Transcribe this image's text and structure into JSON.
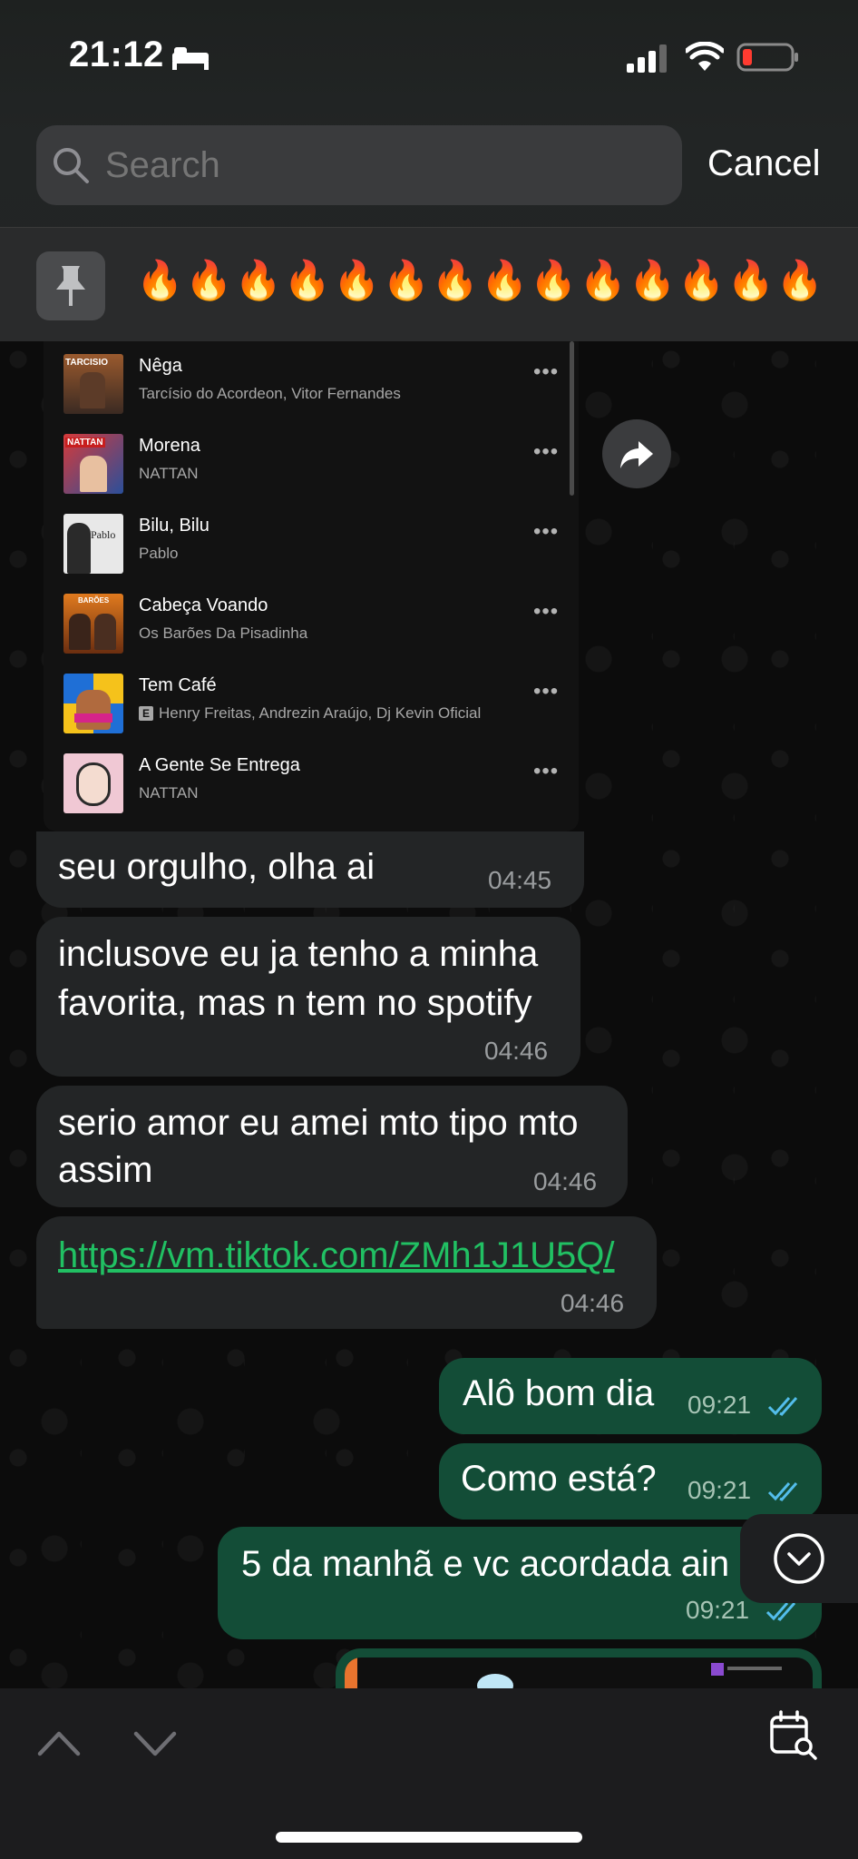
{
  "status_bar": {
    "time": "21:12"
  },
  "search": {
    "placeholder": "Search",
    "cancel_label": "Cancel"
  },
  "pinned": {
    "text": "🔥🔥🔥🔥🔥🔥🔥🔥🔥🔥🔥🔥🔥🔥"
  },
  "playlist": {
    "tracks": [
      {
        "title": "Nêga",
        "artist": "Tarcísio do Acordeon, Vitor Fernandes",
        "art_text": "TARCISIO",
        "explicit": false
      },
      {
        "title": "Morena",
        "artist": "NATTAN",
        "art_text": "NATTAN",
        "explicit": false
      },
      {
        "title": "Bilu, Bilu",
        "artist": "Pablo",
        "art_text": "Pablo",
        "explicit": false
      },
      {
        "title": "Cabeça Voando",
        "artist": "Os Barões Da Pisadinha",
        "art_text": "BARÕES",
        "explicit": false
      },
      {
        "title": "Tem Café",
        "artist": "Henry Freitas, Andrezin Araújo, Dj Kevin Oficial",
        "explicit_badge": "E",
        "explicit": true
      },
      {
        "title": "A Gente Se Entrega",
        "artist": "NATTAN",
        "explicit": false
      }
    ]
  },
  "messages": [
    {
      "direction": "in",
      "text": "seu orgulho, olha ai",
      "time": "04:45"
    },
    {
      "direction": "in",
      "lines": [
        "inclusove eu ja tenho a minha",
        "favorita, mas n tem no spotify"
      ],
      "time": "04:46"
    },
    {
      "direction": "in",
      "lines": [
        "serio amor eu amei mto tipo mto",
        "assim"
      ],
      "time": "04:46"
    },
    {
      "direction": "in",
      "link": "https://vm.tiktok.com/ZMh1J1U5Q/",
      "time": "04:46"
    },
    {
      "direction": "out",
      "text": "Alô bom dia",
      "time": "09:21",
      "read": true
    },
    {
      "direction": "out",
      "text": "Como está?",
      "time": "09:21",
      "read": true
    },
    {
      "direction": "out",
      "text": "5 da manhã e vc acordada ain",
      "time": "09:21",
      "read": true
    }
  ],
  "colors": {
    "incoming_bubble": "#232526",
    "outgoing_bubble": "#134d37",
    "link": "#21c063",
    "read_ticks": "#53bdeb",
    "battery_low": "#ff3b30"
  },
  "icons": [
    "bed-icon",
    "signal-icon",
    "wifi-icon",
    "battery-icon",
    "search-icon",
    "pin-icon",
    "forward-icon",
    "chevron-down-circle-icon",
    "chevron-up-icon",
    "chevron-down-icon",
    "calendar-search-icon"
  ]
}
